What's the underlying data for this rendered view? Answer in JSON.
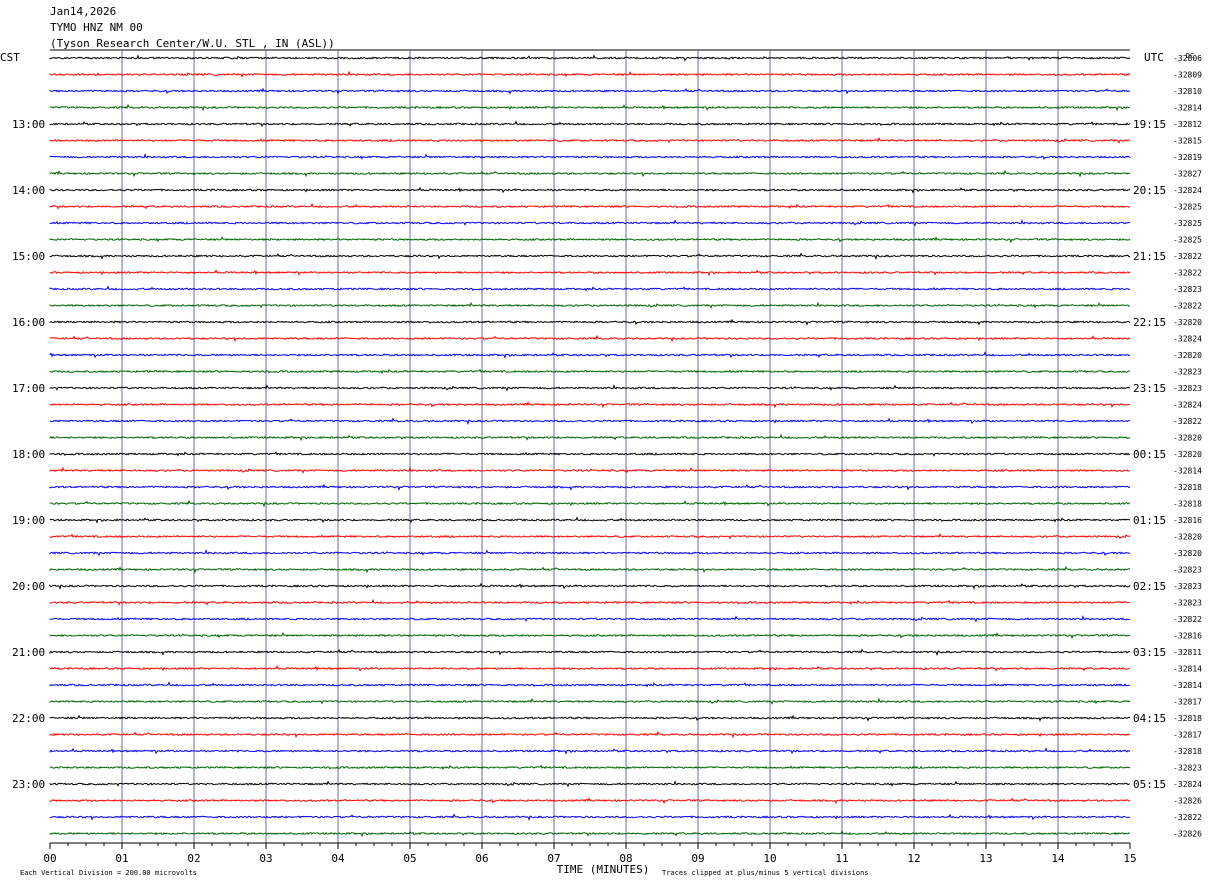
{
  "header": {
    "date": "Jan14,2026",
    "station": "TYMO HNZ NM 00",
    "location": "(Tyson Research Center/W.U. STL , IN (ASL))"
  },
  "chart_data": {
    "type": "line",
    "left_axis_label": "CST",
    "right_axis_label": "UTC",
    "dc_label": "DC",
    "left_hour_labels": [
      "13:00",
      "14:00",
      "15:00",
      "16:00",
      "17:00",
      "18:00",
      "19:00",
      "20:00",
      "21:00",
      "22:00",
      "23:00"
    ],
    "right_hour_labels": [
      "19:15",
      "20:15",
      "21:15",
      "22:15",
      "23:15",
      "00:15",
      "01:15",
      "02:15",
      "03:15",
      "04:15",
      "05:15"
    ],
    "dc_offsets": [
      "-32806",
      "-32809",
      "-32810",
      "-32814",
      "-32812",
      "-32815",
      "-32819",
      "-32827",
      "-32824",
      "-32825",
      "-32825",
      "-32825",
      "-32822",
      "-32822",
      "-32823",
      "-32822",
      "-32820",
      "-32824",
      "-32820",
      "-32823",
      "-32823",
      "-32824",
      "-32822",
      "-32820",
      "-32820",
      "-32814",
      "-32818",
      "-32818",
      "-32816",
      "-32820",
      "-32820",
      "-32823",
      "-32823",
      "-32823",
      "-32822",
      "-32816",
      "-32811",
      "-32814",
      "-32814",
      "-32817",
      "-32818",
      "-32817",
      "-32818",
      "-32823",
      "-32824",
      "-32826",
      "-32822",
      "-32826"
    ],
    "trace_colors": [
      "#000000",
      "#ff0000",
      "#0000ff",
      "#006400"
    ],
    "x_ticks": [
      "00",
      "01",
      "02",
      "03",
      "04",
      "05",
      "06",
      "07",
      "08",
      "09",
      "10",
      "11",
      "12",
      "13",
      "14",
      "15"
    ],
    "xlabel": "TIME (MINUTES)",
    "xlim": [
      0,
      15
    ],
    "footer_left": "Each Vertical Division =  200.00 microvolts",
    "footer_right": "Traces clipped at plus/minus 5 vertical divisions"
  }
}
